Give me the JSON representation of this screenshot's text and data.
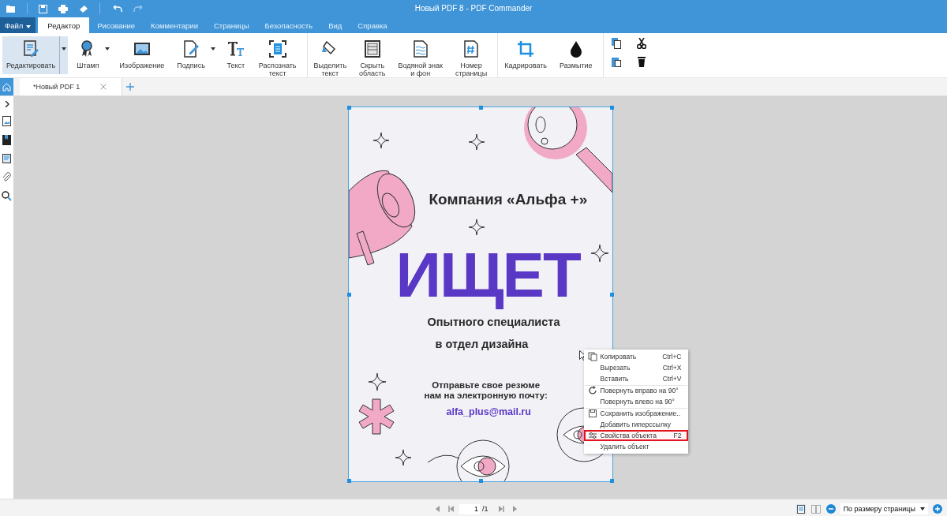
{
  "window": {
    "title": "Новый PDF 8 - PDF Commander"
  },
  "menu_tabs": [
    {
      "label": "Файл",
      "kind": "file",
      "selected": false
    },
    {
      "label": "Редактор",
      "kind": "tab",
      "selected": true
    },
    {
      "label": "Рисование",
      "kind": "tab",
      "selected": false
    },
    {
      "label": "Комментарии",
      "kind": "tab",
      "selected": false
    },
    {
      "label": "Страницы",
      "kind": "tab",
      "selected": false
    },
    {
      "label": "Безопасность",
      "kind": "tab",
      "selected": false
    },
    {
      "label": "Вид",
      "kind": "tab",
      "selected": false
    },
    {
      "label": "Справка",
      "kind": "tab",
      "selected": false
    }
  ],
  "ribbon_groups": [
    {
      "items": [
        {
          "label": "Редактировать",
          "kind": "edit",
          "dropdown": true,
          "selected": true
        },
        {
          "label": "Штамп",
          "kind": "stamp",
          "dropdown": true,
          "selected": false
        },
        {
          "label": "Изображение",
          "kind": "image",
          "dropdown": false,
          "selected": false
        },
        {
          "label": "Подпись",
          "kind": "sign",
          "dropdown": true,
          "selected": false
        },
        {
          "label": "Текст",
          "kind": "text",
          "dropdown": false,
          "selected": false
        },
        {
          "label": "Распознать текст",
          "kind": "ocr",
          "dropdown": false,
          "selected": false
        }
      ]
    },
    {
      "items": [
        {
          "label": "Выделить текст",
          "kind": "highlight",
          "dropdown": false,
          "selected": false
        },
        {
          "label": "Скрыть область",
          "kind": "hide",
          "dropdown": false,
          "selected": false
        },
        {
          "label": "Водяной знак и фон",
          "kind": "watermark",
          "dropdown": false,
          "selected": false
        },
        {
          "label": "Номер страницы",
          "kind": "pagenum",
          "dropdown": false,
          "selected": false
        }
      ]
    },
    {
      "items": [
        {
          "label": "Кадрировать",
          "kind": "crop",
          "dropdown": false,
          "selected": false
        },
        {
          "label": "Размытие",
          "kind": "blur",
          "dropdown": false,
          "selected": false
        }
      ]
    }
  ],
  "doc_tabs": [
    {
      "label": "*Новый PDF 1",
      "selected": true
    }
  ],
  "poster": {
    "company": "Компания «Альфа +»",
    "headline": "ИЩЕТ",
    "subtitle": [
      "Опытного специалиста",
      "в отдел дизайна"
    ],
    "contact": [
      "Отправьте свое резюме",
      "нам на электронную почту:"
    ],
    "email": "alfa_plus@mail.ru"
  },
  "context_menu": [
    {
      "label": "Копировать",
      "shortcut": "Ctrl+C",
      "kind": "copy",
      "group_start": false,
      "highlighted": false
    },
    {
      "label": "Вырезать",
      "shortcut": "Ctrl+X",
      "kind": "plain",
      "group_start": false,
      "highlighted": false
    },
    {
      "label": "Вставить",
      "shortcut": "Ctrl+V",
      "kind": "plain",
      "group_start": false,
      "highlighted": false
    },
    {
      "label": "Повернуть вправо на 90°",
      "kind": "rotate",
      "group_start": true,
      "highlighted": false
    },
    {
      "label": "Повернуть влево на 90°",
      "kind": "plain",
      "group_start": false,
      "highlighted": false
    },
    {
      "label": "Сохранить изображение..",
      "kind": "save",
      "group_start": true,
      "highlighted": false
    },
    {
      "label": "Добавить гиперссылку",
      "kind": "plain",
      "group_start": false,
      "highlighted": false
    },
    {
      "label": "Свойства объекта",
      "shortcut": "F2",
      "kind": "properties",
      "group_start": false,
      "highlighted": true
    },
    {
      "label": "Удалить объект",
      "kind": "plain",
      "group_start": false,
      "highlighted": false
    }
  ],
  "status_bar": {
    "page_value": "1",
    "page_total": "/1",
    "zoom": "По размеру страницы"
  }
}
